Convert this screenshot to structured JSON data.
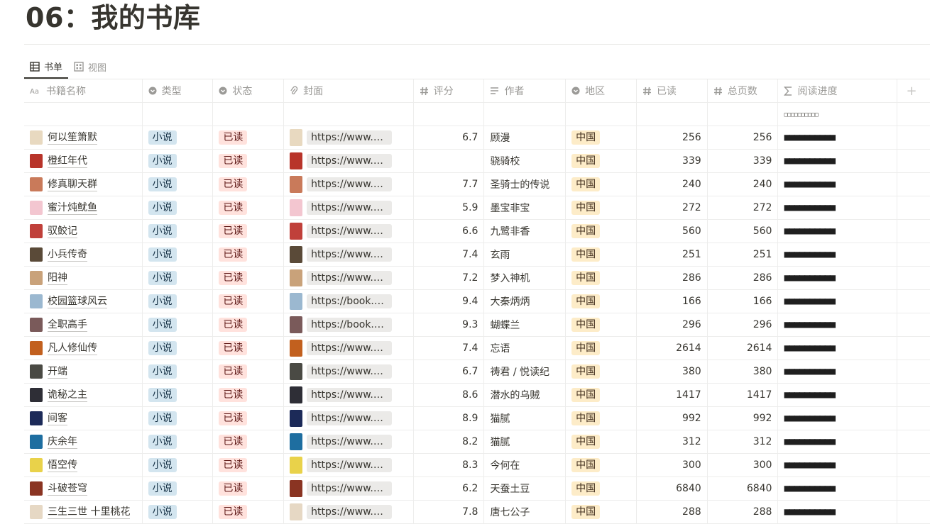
{
  "page": {
    "title": "06：我的书库"
  },
  "views": [
    {
      "label": "书单",
      "icon": "table-icon",
      "active": true
    },
    {
      "label": "视图",
      "icon": "gallery-icon",
      "active": false
    }
  ],
  "columns": [
    {
      "label": "书籍名称",
      "icon": "text-type-icon"
    },
    {
      "label": "类型",
      "icon": "select-icon"
    },
    {
      "label": "状态",
      "icon": "select-icon"
    },
    {
      "label": "封面",
      "icon": "paperclip-icon"
    },
    {
      "label": "评分",
      "icon": "hash-icon"
    },
    {
      "label": "作者",
      "icon": "lines-icon"
    },
    {
      "label": "地区",
      "icon": "select-icon"
    },
    {
      "label": "已读",
      "icon": "hash-icon"
    },
    {
      "label": "总页数",
      "icon": "hash-icon"
    },
    {
      "label": "阅读进度",
      "icon": "sigma-icon"
    }
  ],
  "summary_row": {
    "progress": "□□□□□□□□□□"
  },
  "rows": [
    {
      "name": "何以笙箫默",
      "type": "小说",
      "status": "已读",
      "cover": "https://www.no...",
      "rating": "6.7",
      "author": "顾漫",
      "region": "中国",
      "read": "256",
      "total": "256",
      "progress": "■■■■■■■■■■",
      "cover_color": "#e8d9c0"
    },
    {
      "name": "橙红年代",
      "type": "小说",
      "status": "已读",
      "cover": "https://www.no...",
      "rating": "",
      "author": "骁骑校",
      "region": "中国",
      "read": "339",
      "total": "339",
      "progress": "■■■■■■■■■■",
      "cover_color": "#b8342a"
    },
    {
      "name": "修真聊天群",
      "type": "小说",
      "status": "已读",
      "cover": "https://www.no...",
      "rating": "7.7",
      "author": "圣骑士的传说",
      "region": "中国",
      "read": "240",
      "total": "240",
      "progress": "■■■■■■■■■■",
      "cover_color": "#c97a5a"
    },
    {
      "name": "蜜汁炖鱿鱼",
      "type": "小说",
      "status": "已读",
      "cover": "https://www.no...",
      "rating": "5.9",
      "author": "墨宝非宝",
      "region": "中国",
      "read": "272",
      "total": "272",
      "progress": "■■■■■■■■■■",
      "cover_color": "#f3c6d0"
    },
    {
      "name": "驭鲛记",
      "type": "小说",
      "status": "已读",
      "cover": "https://www.no...",
      "rating": "6.6",
      "author": "九鹭非香",
      "region": "中国",
      "read": "560",
      "total": "560",
      "progress": "■■■■■■■■■■",
      "cover_color": "#c0403a"
    },
    {
      "name": "小兵传奇",
      "type": "小说",
      "status": "已读",
      "cover": "https://www.no...",
      "rating": "7.4",
      "author": "玄雨",
      "region": "中国",
      "read": "251",
      "total": "251",
      "progress": "■■■■■■■■■■",
      "cover_color": "#5a4a38"
    },
    {
      "name": "阳神",
      "type": "小说",
      "status": "已读",
      "cover": "https://www.no...",
      "rating": "7.2",
      "author": "梦入神机",
      "region": "中国",
      "read": "286",
      "total": "286",
      "progress": "■■■■■■■■■■",
      "cover_color": "#c9a27a"
    },
    {
      "name": "校园篮球风云",
      "type": "小说",
      "status": "已读",
      "cover": "https://book.do...",
      "rating": "9.4",
      "author": "大秦炳炳",
      "region": "中国",
      "read": "166",
      "total": "166",
      "progress": "■■■■■■■■■■",
      "cover_color": "#9bb8d0"
    },
    {
      "name": "全职高手",
      "type": "小说",
      "status": "已读",
      "cover": "https://book.do...",
      "rating": "9.3",
      "author": "蝴蝶兰",
      "region": "中国",
      "read": "296",
      "total": "296",
      "progress": "■■■■■■■■■■",
      "cover_color": "#7a5a5a"
    },
    {
      "name": "凡人修仙传",
      "type": "小说",
      "status": "已读",
      "cover": "https://www.no...",
      "rating": "7.4",
      "author": "忘语",
      "region": "中国",
      "read": "2614",
      "total": "2614",
      "progress": "■■■■■■■■■■",
      "cover_color": "#c2601e"
    },
    {
      "name": "开端",
      "type": "小说",
      "status": "已读",
      "cover": "https://www.no...",
      "rating": "6.7",
      "author": "祷君 / 悦读纪",
      "region": "中国",
      "read": "380",
      "total": "380",
      "progress": "■■■■■■■■■■",
      "cover_color": "#4a4a44"
    },
    {
      "name": "诡秘之主",
      "type": "小说",
      "status": "已读",
      "cover": "https://www.no...",
      "rating": "8.6",
      "author": "潜水的乌贼",
      "region": "中国",
      "read": "1417",
      "total": "1417",
      "progress": "■■■■■■■■■■",
      "cover_color": "#2e2e36"
    },
    {
      "name": "间客",
      "type": "小说",
      "status": "已读",
      "cover": "https://www.no...",
      "rating": "8.9",
      "author": "猫腻",
      "region": "中国",
      "read": "992",
      "total": "992",
      "progress": "■■■■■■■■■■",
      "cover_color": "#1c2a58"
    },
    {
      "name": "庆余年",
      "type": "小说",
      "status": "已读",
      "cover": "https://www.no...",
      "rating": "8.2",
      "author": "猫腻",
      "region": "中国",
      "read": "312",
      "total": "312",
      "progress": "■■■■■■■■■■",
      "cover_color": "#1e6ea0"
    },
    {
      "name": "悟空传",
      "type": "小说",
      "status": "已读",
      "cover": "https://www.no...",
      "rating": "8.3",
      "author": "今何在",
      "region": "中国",
      "read": "300",
      "total": "300",
      "progress": "■■■■■■■■■■",
      "cover_color": "#e9d24a"
    },
    {
      "name": "斗破苍穹",
      "type": "小说",
      "status": "已读",
      "cover": "https://www.no...",
      "rating": "6.2",
      "author": "天蚕土豆",
      "region": "中国",
      "read": "6840",
      "total": "6840",
      "progress": "■■■■■■■■■■",
      "cover_color": "#8a3422"
    },
    {
      "name": "三生三世 十里桃花",
      "type": "小说",
      "status": "已读",
      "cover": "https://www.no...",
      "rating": "7.8",
      "author": "唐七公子",
      "region": "中国",
      "read": "288",
      "total": "288",
      "progress": "■■■■■■■■■■",
      "cover_color": "#e6d8c4"
    }
  ],
  "colors": {
    "type_tag_bg": "#d3e5ef",
    "status_tag_bg": "#ffe2dd",
    "region_tag_bg": "#fdecc8"
  },
  "add_column": "+"
}
